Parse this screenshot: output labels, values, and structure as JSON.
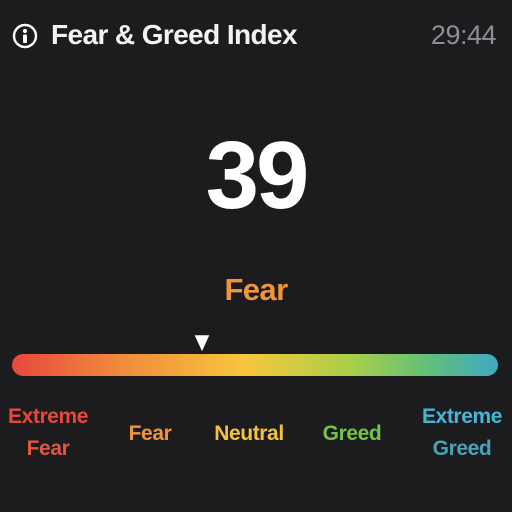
{
  "header": {
    "title": "Fear & Greed Index",
    "time": "29:44",
    "icon": "info-icon"
  },
  "index": {
    "value": "39",
    "level": 0.39,
    "sentiment": "Fear",
    "sentiment_color": "#f0953a"
  },
  "scale": {
    "labels": [
      {
        "line1": "Extreme",
        "line2": "Fear",
        "color1": "#e8483c",
        "color2": "#e0573f"
      },
      {
        "line1": "Fear",
        "line2": "",
        "color1": "#f0953a",
        "color2": ""
      },
      {
        "line1": "Neutral",
        "line2": "",
        "color1": "#f2c23e",
        "color2": ""
      },
      {
        "line1": "Greed",
        "line2": "",
        "color1": "#6fc64a",
        "color2": ""
      },
      {
        "line1": "Extreme",
        "line2": "Greed",
        "color1": "#46b6d6",
        "color2": "#4aa2b6"
      }
    ]
  }
}
